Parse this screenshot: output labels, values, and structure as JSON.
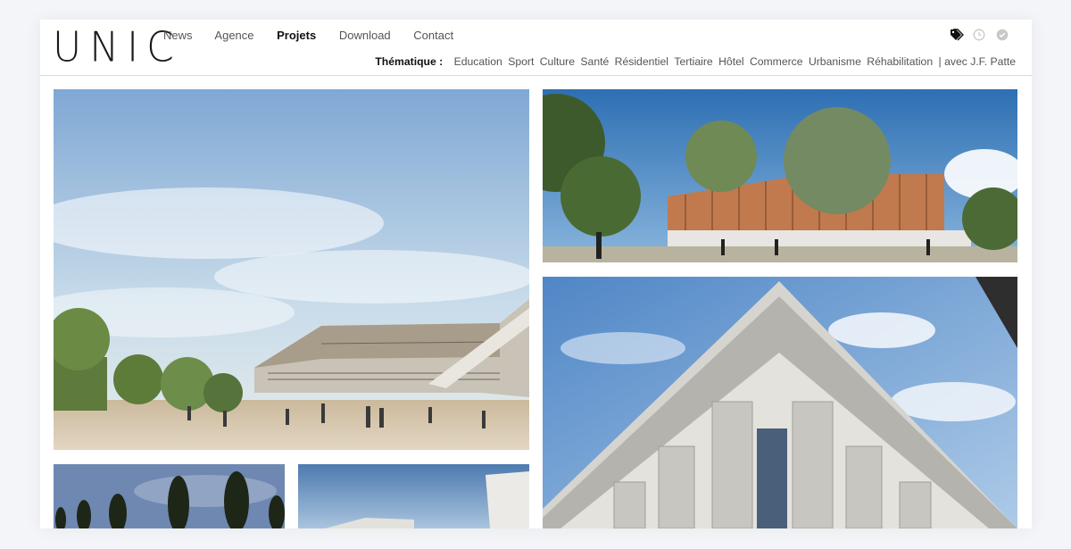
{
  "brand": {
    "logo": "UNIC"
  },
  "nav": {
    "items": [
      {
        "label": "News"
      },
      {
        "label": "Agence"
      },
      {
        "label": "Projets",
        "active": true
      },
      {
        "label": "Download"
      },
      {
        "label": "Contact"
      }
    ]
  },
  "thematique": {
    "label": "Thématique :",
    "items": [
      "Education",
      "Sport",
      "Culture",
      "Santé",
      "Résidentiel",
      "Tertiaire",
      "Hôtel",
      "Commerce",
      "Urbanisme",
      "Réhabilitation",
      "| avec J.F. Patte"
    ]
  },
  "header_icons": [
    "tags-icon",
    "clock-icon",
    "check-circle-icon"
  ],
  "colors": {
    "sky": "#9fc1e0",
    "ground": "#d8cdb8",
    "text": "#555555",
    "active": "#111111"
  }
}
